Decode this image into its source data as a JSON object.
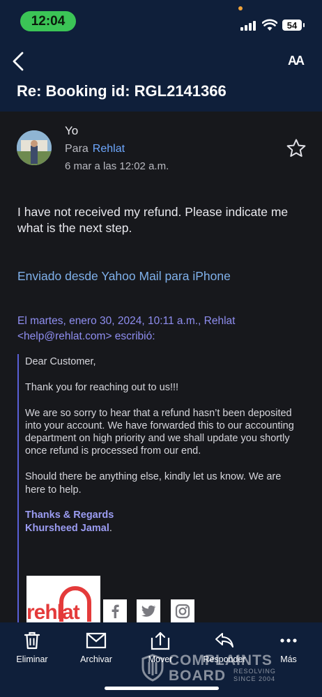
{
  "status_bar": {
    "time": "12:04",
    "battery": "54"
  },
  "header": {
    "subject": "Re: Booking id: RGL2141366",
    "text_size_button": "AA"
  },
  "message": {
    "sender": "Yo",
    "to_prefix": "Para",
    "recipient": "Rehlat",
    "date": "6 mar a las 12:02 a.m.",
    "body": "I have not received my refund.  Please indicate me what is the next step.",
    "sent_from": "Enviado desde Yahoo Mail para iPhone"
  },
  "quoted": {
    "header": "El martes, enero 30, 2024, 10:11 a.m., Rehlat <help@rehlat.com> escribió:",
    "greeting": "Dear Customer,",
    "para1": "Thank you for reaching out to us!!!",
    "para2": "We are so sorry to hear that a refund hasn’t been deposited into your account. We have forwarded this to our accounting department on high priority and we shall update you shortly once refund is processed from our end.",
    "para3": "Should there be anything else, kindly let us know. We are here to help.",
    "signoff": "Thanks & Regards",
    "signer": "Khursheed Jamal",
    "logo": "rehlat"
  },
  "toolbar": {
    "delete": "Eliminar",
    "archive": "Archivar",
    "move": "Mover",
    "reply": "Responder",
    "more": "Más"
  },
  "watermark": {
    "line1": "COMPLAINTS",
    "line2": "BOARD",
    "tag1": "RESOLVING",
    "tag2": "SINCE 2004"
  },
  "colors": {
    "header_bg": "#0f1f3a",
    "body_bg": "#17181c",
    "link": "#6ea8ff",
    "quote_text": "#8f8ef0",
    "status_pill": "#3bc456"
  }
}
